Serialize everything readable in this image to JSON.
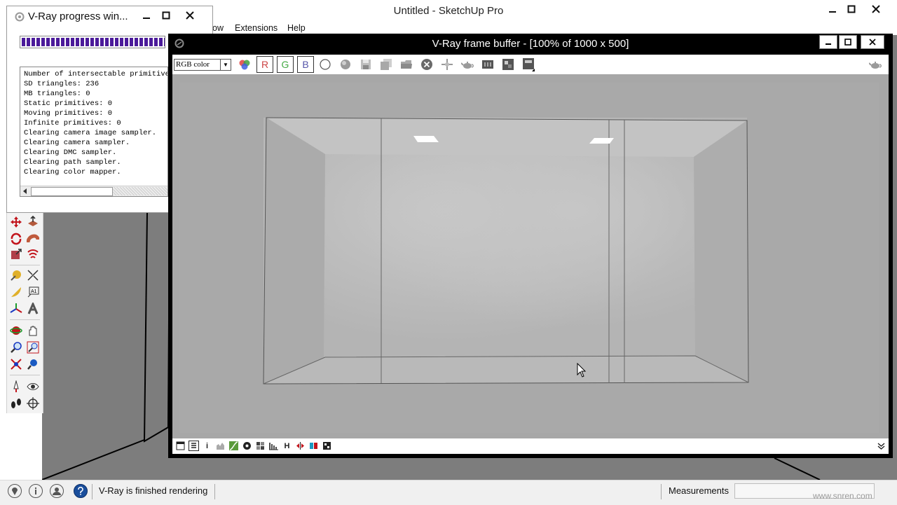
{
  "sketchup": {
    "title": "Untitled - SketchUp Pro",
    "menu": [
      {
        "id": "window",
        "label": "ow"
      },
      {
        "id": "extensions",
        "label": "Extensions"
      },
      {
        "id": "help",
        "label": "Help"
      }
    ],
    "status_text": "V-Ray is finished rendering",
    "measurements_label": "Measurements",
    "measurements_value": "",
    "watermark": "www.snren.com"
  },
  "vray_progress": {
    "title": "V-Ray progress win...",
    "progress": 1.0,
    "log": [
      "Number of intersectable primitives",
      "SD triangles: 236",
      "MB triangles: 0",
      "Static primitives: 0",
      "Moving primitives: 0",
      "Infinite primitives: 0",
      "Clearing camera image sampler.",
      "Clearing camera sampler.",
      "Clearing DMC sampler.",
      "Clearing path sampler.",
      "Clearing color mapper."
    ]
  },
  "frame_buffer": {
    "title": "V-Ray frame buffer - [100% of 1000 x 500]",
    "channel_select": "RGB color",
    "channel_buttons": [
      "R",
      "G",
      "B"
    ],
    "bottom_h_label": "H",
    "bottom_i_label": "i"
  },
  "colors": {
    "progress_bar": "#4b1a9a",
    "viewport_bg": "#7d7d7d",
    "render_bg": "#a7a7a7",
    "frame_buffer_chrome": "#000000"
  }
}
